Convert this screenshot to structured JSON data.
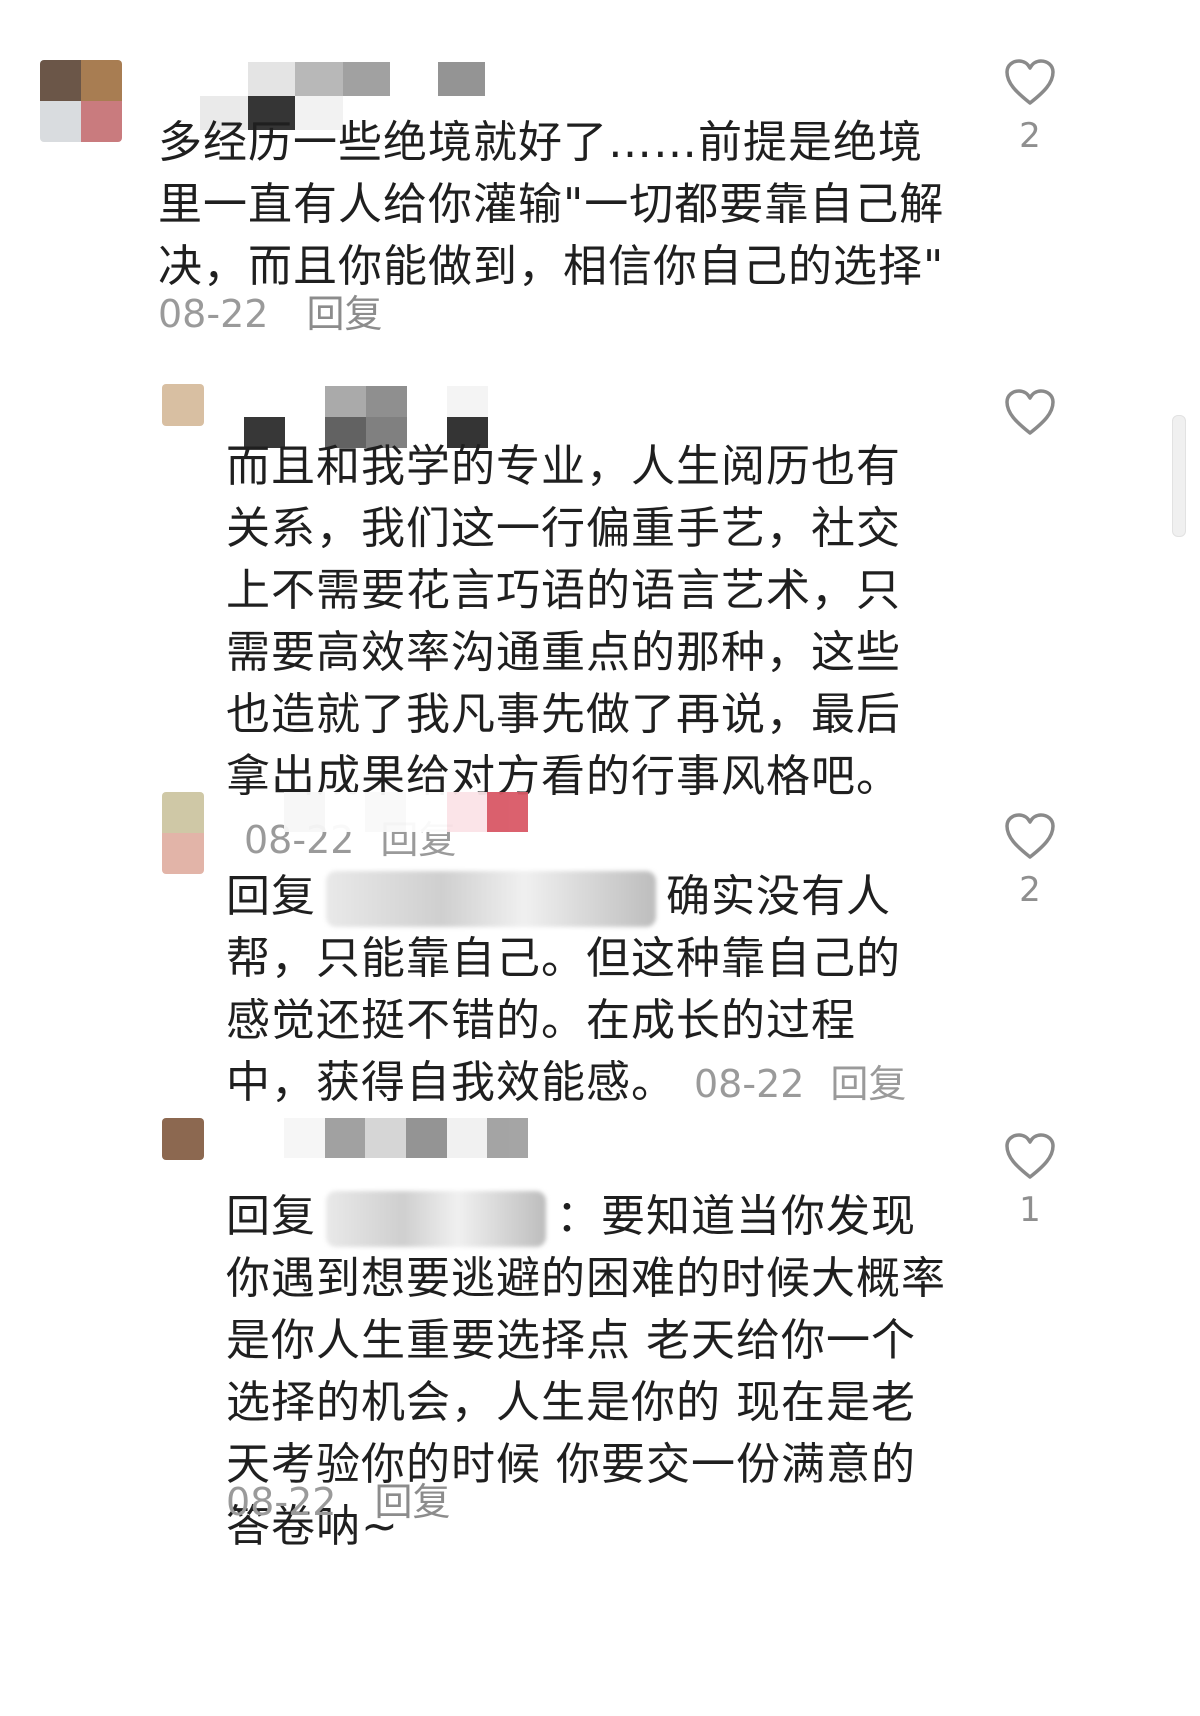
{
  "comments": [
    {
      "text": "多经历一些绝境就好了……前提是绝境里一直有人给你灌输\"一切都要靠自己解决，而且你能做到，相信你自己的选择\"",
      "date": "08-22",
      "reply_label": "回复",
      "likes": "2",
      "avatar_colors": [
        "#6b5648",
        "#a87d52",
        "#d9dcdf",
        "#c97b7e"
      ],
      "name_colors": [
        "#e5e5e5",
        "#b9b9b9",
        "#9a9a9a",
        "#f4f4f4",
        "#8e8e8e"
      ]
    },
    {
      "text": "而且和我学的专业，人生阅历也有关系，我们这一行偏重手艺，社交上不需要花言巧语的语言艺术，只需要高效率沟通重点的那种，这些也造就了我凡事先做了再说，最后拿出成果给对方看的行事风格吧。",
      "date": "08-22",
      "reply_label": "回复",
      "likes": "",
      "avatar_colors": [
        "#d8bfa2"
      ],
      "name_colors": [
        "#2d2d2d",
        "#a9a9a9",
        "#7a7a7a",
        "#f3f3f3"
      ]
    },
    {
      "reply_prefix": "回复",
      "text": "确实没有人帮，只能靠自己。但这种靠自己的感觉还挺不错的。在成长的过程中，获得自我效能感。",
      "date": "08-22",
      "reply_label": "回复",
      "likes": "2",
      "avatar_colors": [
        "#cfc8a6",
        "#e2b4a8"
      ],
      "name_colors": [
        "#f6f6f6",
        "#eeeeee",
        "#fbe3e7",
        "#d95866"
      ]
    },
    {
      "reply_prefix": "回复",
      "text": "：要知道当你发现你遇到想要逃避的困难的时候大概率是你人生重要选择点 老天给你一个选择的机会，人生是你的 现在是老天考验你的时候 你要交一份满意的答卷呐~",
      "date": "08-22",
      "reply_label": "回复",
      "likes": "1",
      "avatar_colors": [
        "#8c6850"
      ],
      "name_colors": [
        "#9d9d9d",
        "#d4d4d4",
        "#8f8f8f",
        "#f1f1f1",
        "#a0a0a0"
      ]
    }
  ]
}
